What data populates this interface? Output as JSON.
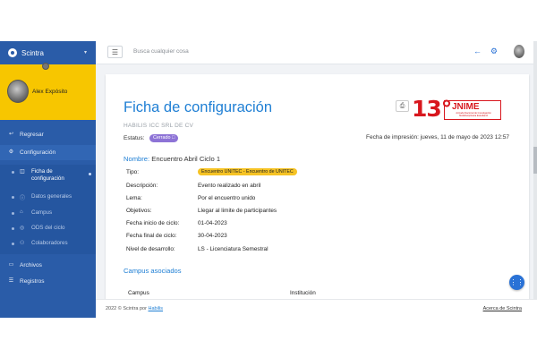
{
  "brand": {
    "name": "Scintra"
  },
  "user": {
    "name": "Alex Expósito"
  },
  "sidebar": {
    "items": [
      {
        "label": "Regresar",
        "icon": "arrow-left-icon"
      },
      {
        "label": "Configuración",
        "icon": "gear-icon"
      },
      {
        "label": "Archivos",
        "icon": "folder-icon"
      },
      {
        "label": "Registros",
        "icon": "list-icon"
      }
    ],
    "subitems": [
      {
        "label": "Ficha de configuración",
        "line1": "Ficha de",
        "line2": "configuración",
        "icon": "document-icon"
      },
      {
        "label": "Datos generales",
        "icon": "info-icon"
      },
      {
        "label": "Campus",
        "icon": "building-icon"
      },
      {
        "label": "ODS del ciclo",
        "icon": "target-icon"
      },
      {
        "label": "Colaboradores",
        "icon": "people-icon"
      }
    ]
  },
  "topbar": {
    "search_placeholder": "Busca cualquier cosa"
  },
  "page": {
    "title": "Ficha de configuración",
    "company": "HABILIS ICC SRL DE CV",
    "status_label": "Estatus:",
    "status_value": "Cerrado",
    "print_label": "Fecha de impresión:",
    "print_date": "jueves, 11 de mayo de 2023 12:57",
    "logo": {
      "number": "13°",
      "name": "JNIME",
      "sub": "Jornada Nacional de Investigación Multidisciplinaria Estudiantil"
    },
    "name_label": "Nombre:",
    "name_value": "Encuentro Abril Ciclo 1",
    "fields": [
      {
        "label": "Tipo:",
        "value": "Encuentro UNITEC - Encuentro de UNITEC"
      },
      {
        "label": "Descripción:",
        "value": "Evento realizado en abril"
      },
      {
        "label": "Lema:",
        "value": "Por el encuentro unido"
      },
      {
        "label": "Objetivos:",
        "value": "Llegar al limite de participantes"
      },
      {
        "label": "Fecha inicio de ciclo:",
        "value": "01-04-2023"
      },
      {
        "label": "Fecha final de ciclo:",
        "value": "30-04-2023"
      },
      {
        "label": "Nivel de desarrollo:",
        "value": "LS - Licenciatura Semestral"
      }
    ],
    "campus_heading": "Campus asociados",
    "columns": [
      "Campus",
      "Institución"
    ]
  },
  "footer": {
    "copyright": "2022 © Scintra por",
    "link": "Habilis",
    "right": "Acerca de Scintra"
  },
  "colors": {
    "accent": "#1f7fd4",
    "sidebar": "#2a5ca8",
    "user_card": "#f7c600",
    "status_badge": "#8d73d6",
    "tipo_badge": "#f6c324",
    "logo_red": "#d8171e"
  }
}
